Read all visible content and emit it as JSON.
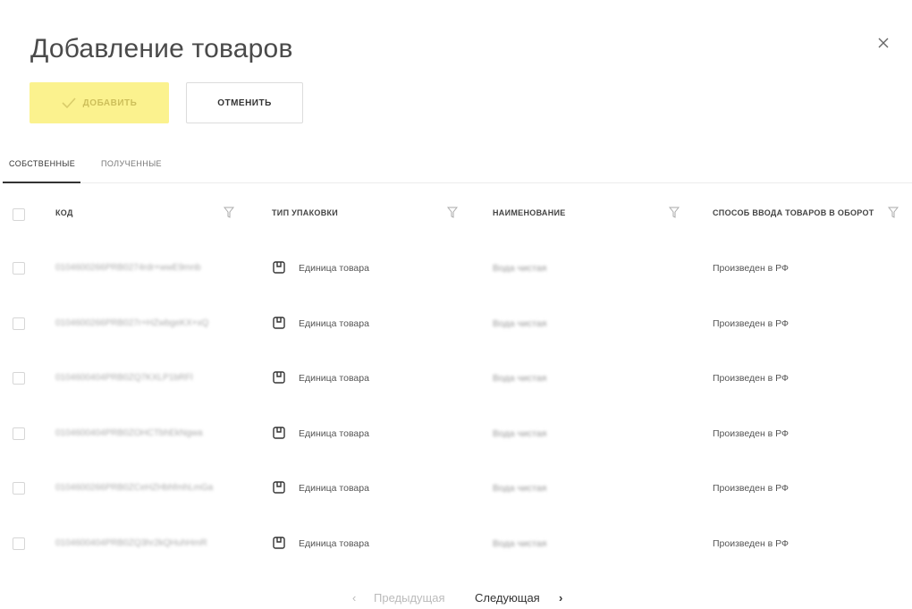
{
  "dialog": {
    "title": "Добавление товаров"
  },
  "actions": {
    "add_label": "ДОБАВИТЬ",
    "cancel_label": "ОТМЕНИТЬ"
  },
  "tabs": [
    {
      "label": "СОБСТВЕННЫЕ",
      "active": true
    },
    {
      "label": "ПОЛУЧЕННЫЕ",
      "active": false
    }
  ],
  "table": {
    "columns": [
      {
        "label": "КОД"
      },
      {
        "label": "ТИП УПАКОВКИ"
      },
      {
        "label": "НАИМЕНОВАНИЕ"
      },
      {
        "label": "СПОСОБ ВВОДА ТОВАРОВ В ОБОРОТ"
      }
    ],
    "rows": [
      {
        "code": "0104600266PRB0274rdr+wwE9mnb",
        "package": "Единица товара",
        "name": "Вода чистая",
        "method": "Произведен в РФ"
      },
      {
        "code": "0104600266PRB027r+HZwbgeKX+xQ",
        "package": "Единица товара",
        "name": "Вода чистая",
        "method": "Произведен в РФ"
      },
      {
        "code": "0104600404PRB0ZQ7KXLP1bRFl",
        "package": "Единица товара",
        "name": "Вода чистая",
        "method": "Произведен в РФ"
      },
      {
        "code": "0104600404PRB0ZOHCTbhEkNgwa",
        "package": "Единица товара",
        "name": "Вода чистая",
        "method": "Произведен в РФ"
      },
      {
        "code": "0104600266PRB0ZCeHZHbhfmhLmGa",
        "package": "Единица товара",
        "name": "Вода чистая",
        "method": "Произведен в РФ"
      },
      {
        "code": "0104600404PRB0ZQ3hr2kQHuhHmR",
        "package": "Единица товара",
        "name": "Вода чистая",
        "method": "Произведен в РФ"
      }
    ]
  },
  "pagination": {
    "prev_label": "Предыдущая",
    "next_label": "Следующая",
    "prev_icon": "‹",
    "next_icon": "›"
  },
  "colors": {
    "accent": "#fbf28e",
    "text": "#2d2d2d"
  }
}
